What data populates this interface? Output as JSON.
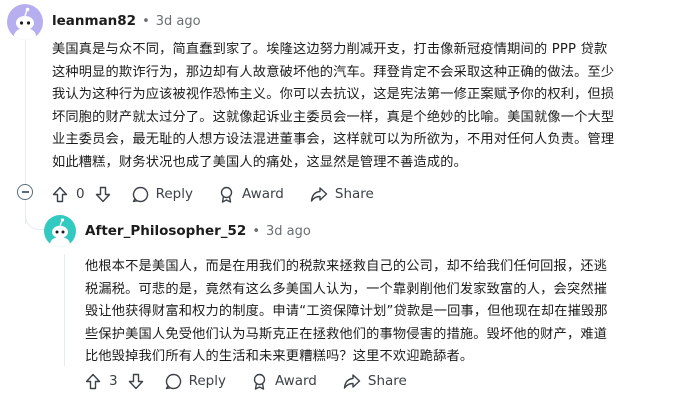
{
  "comments": [
    {
      "username": "leanman82",
      "separator": "•",
      "age": "3d ago",
      "body_lines": [
        "美国真是与众不同，简直蠢到家了。埃隆这边努力削减开支，打击像新冠疫情期间的 PPP 贷款",
        "这种明显的欺诈行为，那边却有人故意破坏他的汽车。拜登肯定不会采取这种正确的做法。至少",
        "我认为这种行为应该被视作恐怖主义。你可以去抗议，这是宪法第一修正案赋予你的权利，但损",
        "坏同胞的财产就太过分了。这就像起诉业主委员会一样，真是个绝妙的比喻。美国就像一个大型",
        "业主委员会，最无耻的人想方设法混进董事会，这样就可以为所欲为，不用对任何人负责。管理",
        "如此糟糕，财务状况也成了美国人的痛处，这显然是管理不善造成的。"
      ],
      "vote_count": "0",
      "reply_label": "Reply",
      "award_label": "Award",
      "share_label": "Share"
    },
    {
      "username": "After_Philosopher_52",
      "separator": "•",
      "age": "3d ago",
      "body_lines": [
        "他根本不是美国人，而是在用我们的税款来拯救自己的公司，却不给我们任何回报，还逃",
        "税漏税。可悲的是，竟然有这么多美国人认为，一个靠剥削他们发家致富的人，会突然摧",
        "毁让他获得财富和权力的制度。申请“工资保障计划”贷款是一回事，但他现在却在摧毁那",
        "些保护美国人免受他们认为马斯克正在拯救他们的事物侵害的措施。毁坏他的财产，难道",
        "比他毁掉我们所有人的生活和未来更糟糕吗？这里不欢迎跪舔者。"
      ],
      "vote_count": "3",
      "reply_label": "Reply",
      "award_label": "Award",
      "share_label": "Share"
    }
  ],
  "icons": {
    "upvote": "upvote-arrow-icon",
    "downvote": "downvote-arrow-icon",
    "reply": "speech-bubble-icon",
    "award": "award-ribbon-icon",
    "share": "share-arrow-icon",
    "collapse": "collapse-minus-icon"
  },
  "colors": {
    "avatar_bg_1": "#b7aef0",
    "avatar_bg_2": "#31c9c0",
    "thread_line": "#e5ebee",
    "meta_text": "#6a6f73"
  }
}
